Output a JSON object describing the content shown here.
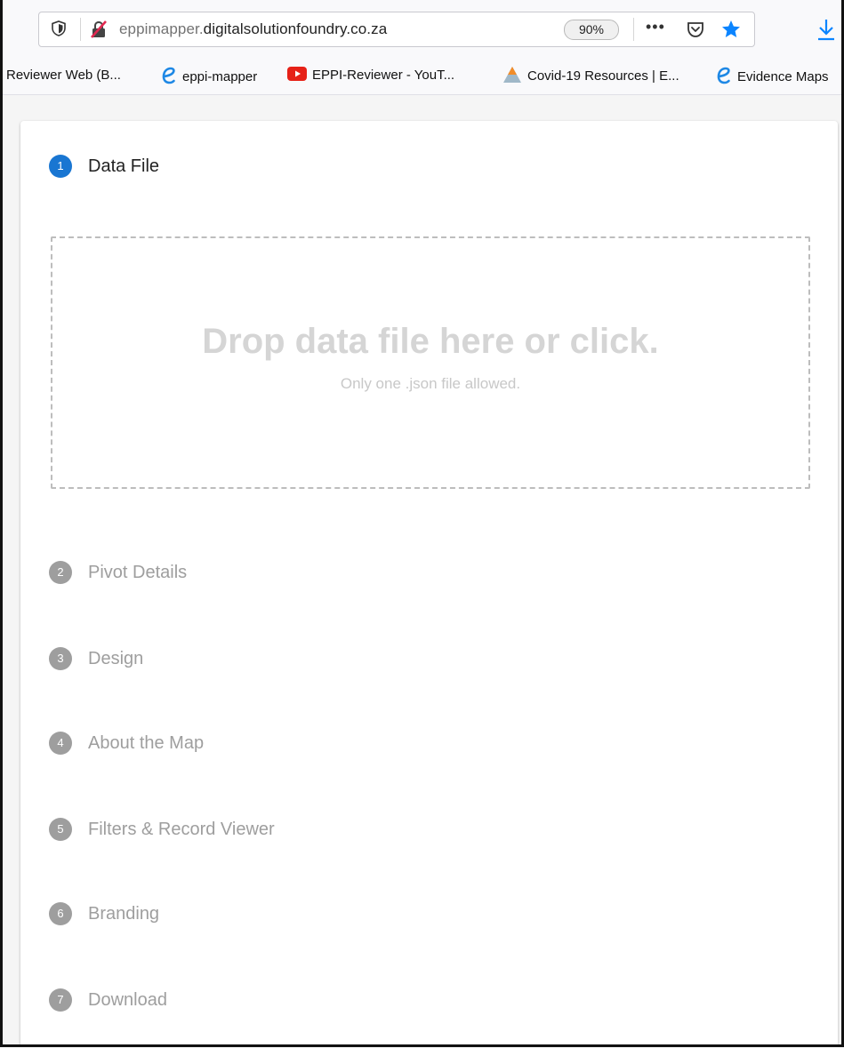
{
  "browser": {
    "url_prefix": "eppimapper.",
    "url_domain": "digitalsolutionfoundry.co.za",
    "zoom": "90%",
    "more_label": "•••"
  },
  "bookmarks": [
    {
      "label": "Reviewer Web (B...",
      "icon": "none"
    },
    {
      "label": "eppi-mapper",
      "icon": "e-logo-icon"
    },
    {
      "label": "EPPI-Reviewer - YouT...",
      "icon": "youtube-icon"
    },
    {
      "label": "Covid-19 Resources | E...",
      "icon": "triangle-logo-icon"
    },
    {
      "label": "Evidence Maps",
      "icon": "e-logo-icon"
    }
  ],
  "wizard": {
    "steps": [
      {
        "num": "1",
        "label": "Data File",
        "active": true
      },
      {
        "num": "2",
        "label": "Pivot Details",
        "active": false
      },
      {
        "num": "3",
        "label": "Design",
        "active": false
      },
      {
        "num": "4",
        "label": "About the Map",
        "active": false
      },
      {
        "num": "5",
        "label": "Filters & Record Viewer",
        "active": false
      },
      {
        "num": "6",
        "label": "Branding",
        "active": false
      },
      {
        "num": "7",
        "label": "Download",
        "active": false
      }
    ],
    "dropzone": {
      "title": "Drop data file here or click.",
      "subtitle": "Only one .json file allowed."
    }
  },
  "colors": {
    "active_step": "#1976d2",
    "inactive_step": "#9e9e9e",
    "star": "#0a84ff",
    "download": "#0a84ff"
  }
}
